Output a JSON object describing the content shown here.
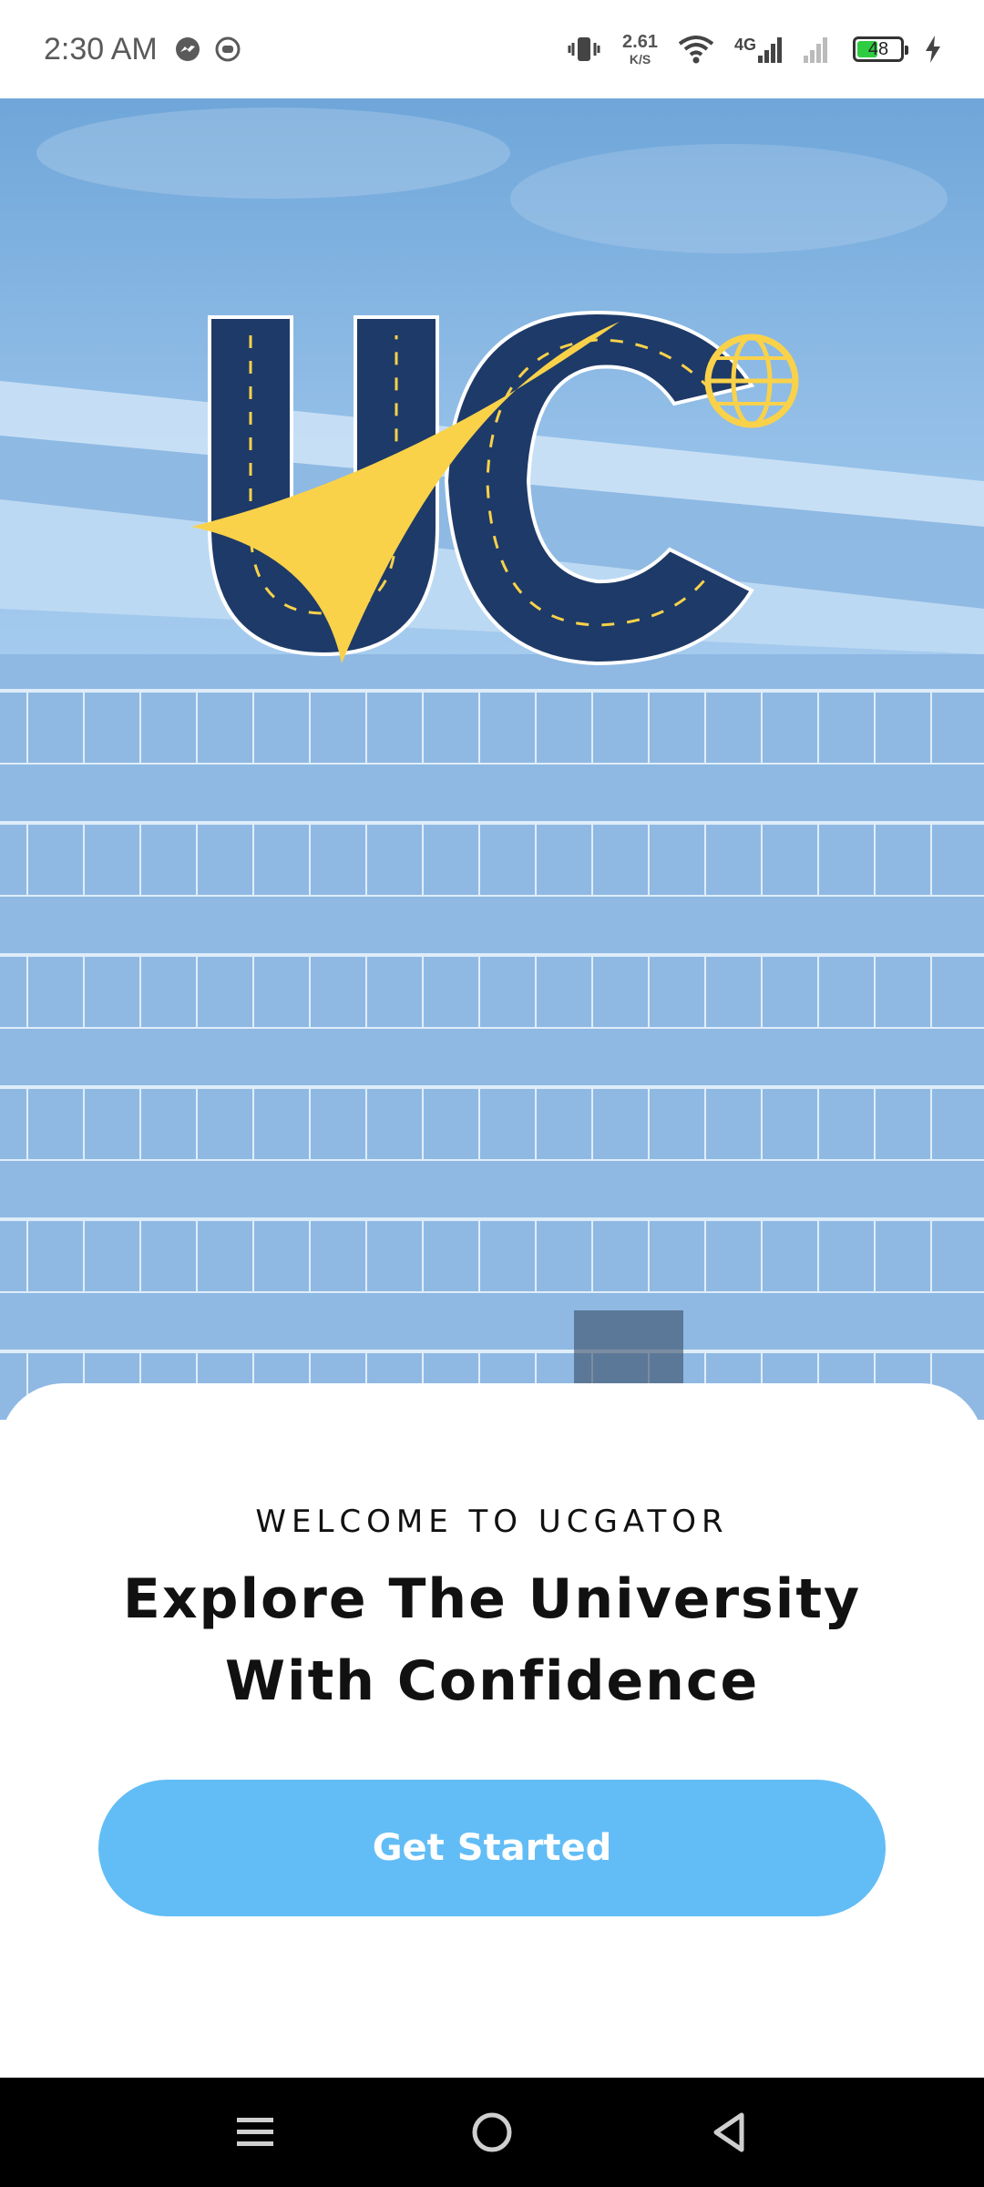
{
  "status_bar": {
    "time": "2:30 AM",
    "net_speed_value": "2.61",
    "net_speed_unit": "K/S",
    "network_type": "4G",
    "battery_level": "48",
    "battery_fill_fraction": 0.48,
    "battery_color": "#2ecc40",
    "left_icons": [
      "messenger-icon",
      "notification-app-icon"
    ],
    "right_icons": [
      "vibrate-icon",
      "wifi-icon",
      "signal-4g-icon",
      "signal-icon",
      "battery-icon",
      "charging-icon"
    ]
  },
  "hero": {
    "logo_text": "UC",
    "logo_colors": {
      "navy": "#1e3a68",
      "yellow": "#f9d24a"
    }
  },
  "welcome": {
    "subtitle": "WELCOME TO UCGATOR",
    "headline_line1": "Explore The University",
    "headline_line2": "With Confidence"
  },
  "actions": {
    "get_started_label": "Get Started",
    "accent_color": "#62bdf6"
  },
  "nav_bar": {
    "icons": [
      "menu-icon",
      "home-icon",
      "back-icon"
    ]
  }
}
